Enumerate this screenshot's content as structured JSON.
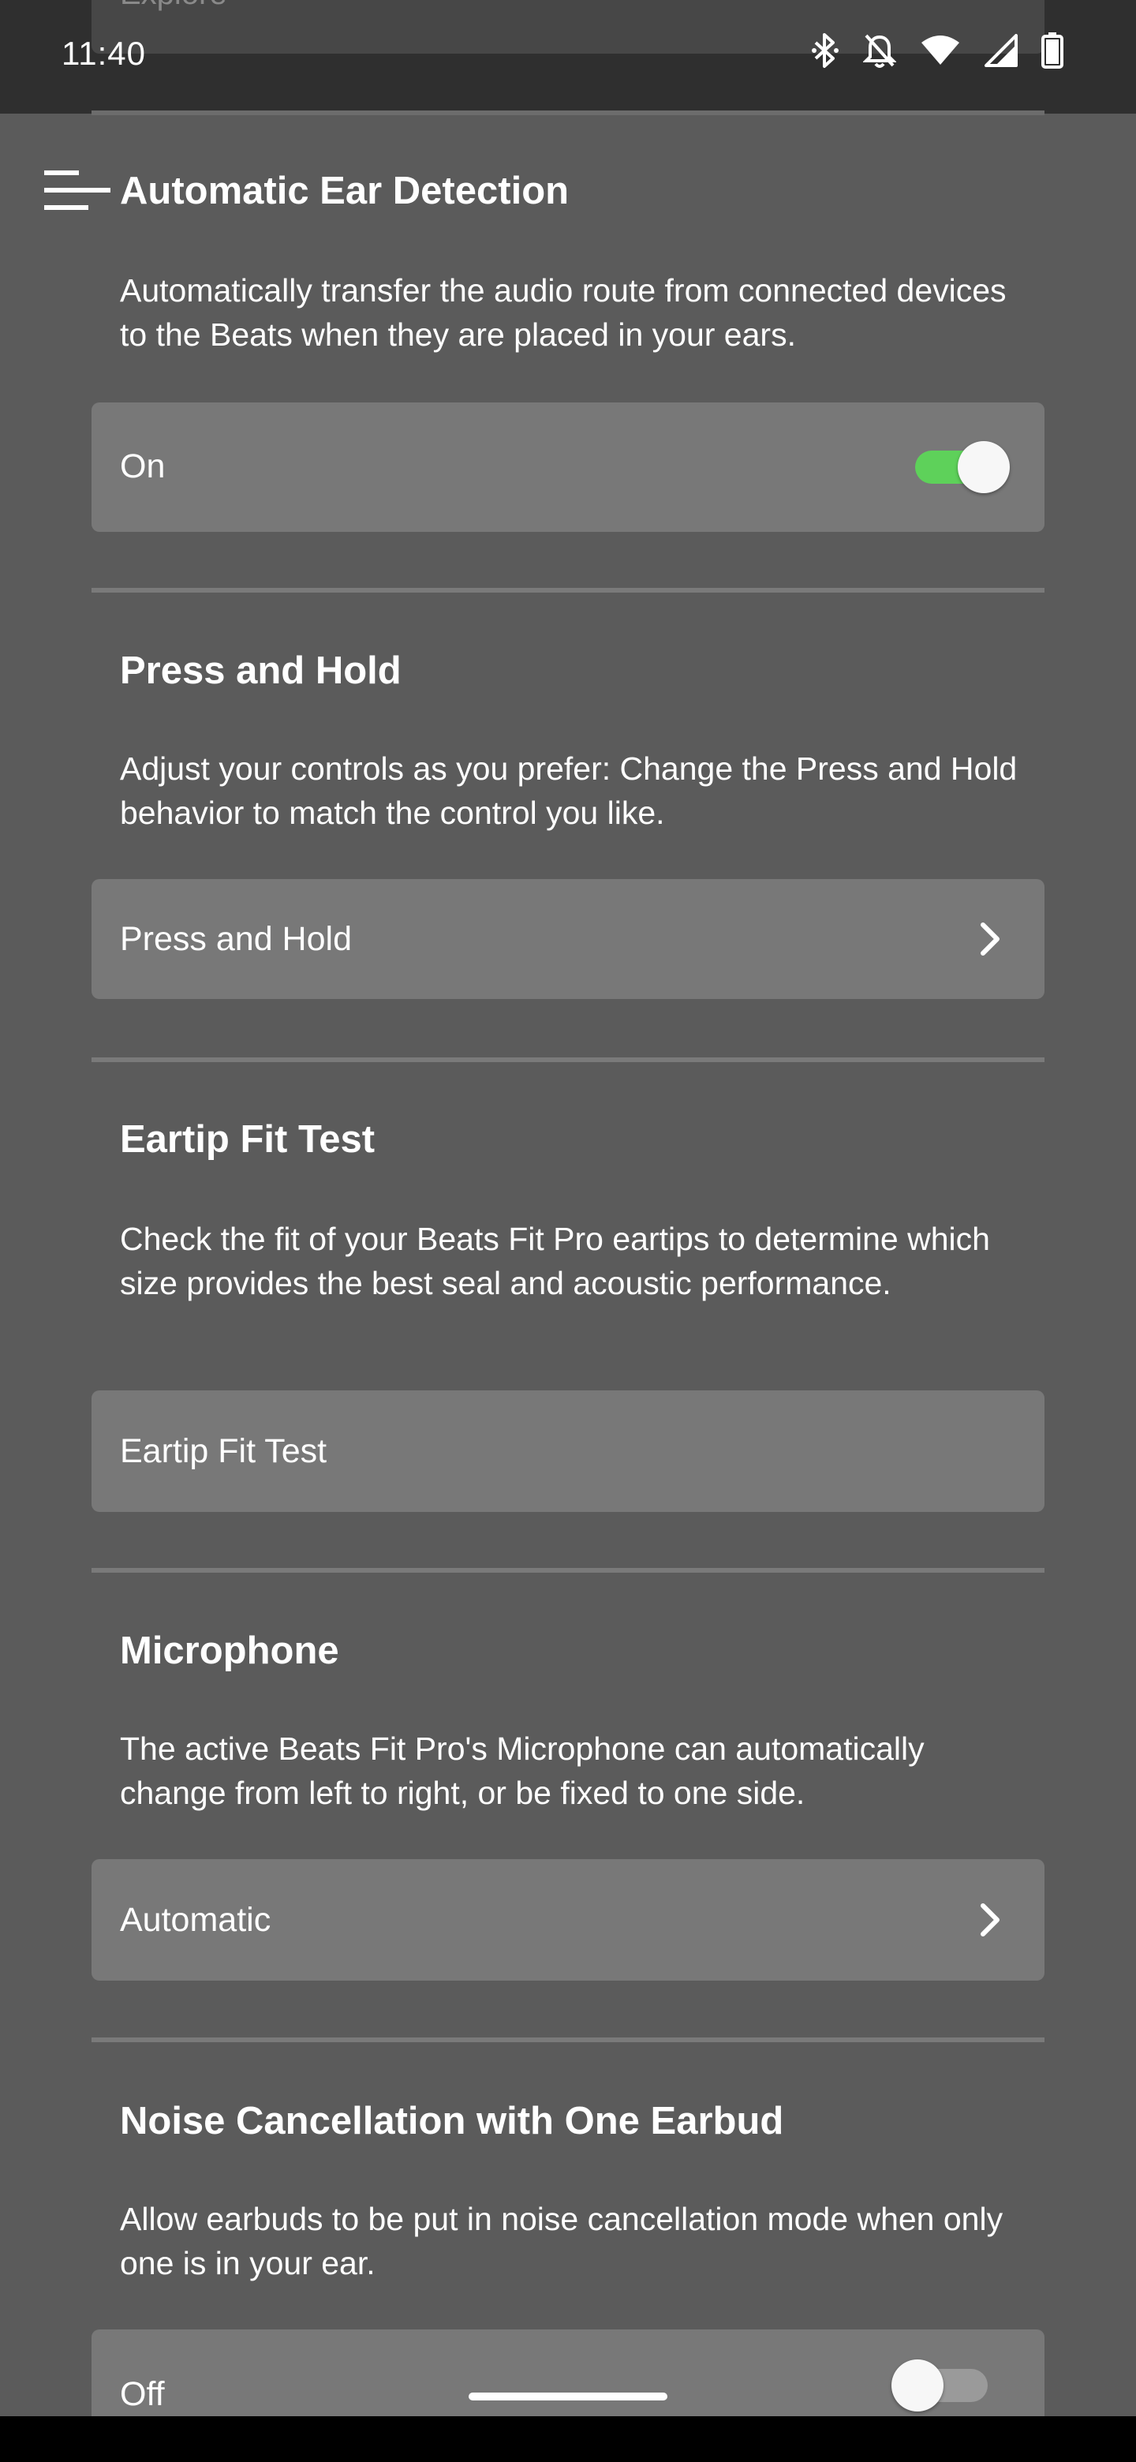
{
  "status_bar": {
    "time": "11:40",
    "icons": [
      "bluetooth-icon",
      "notifications-off-icon",
      "wifi-icon",
      "cell-signal-icon",
      "battery-icon"
    ]
  },
  "peek": {
    "label": "Explore"
  },
  "header": {
    "title": "Automatic Ear Detection"
  },
  "ear_detection": {
    "description": "Automatically transfer the audio route from connected devices to the Beats when they are placed in your ears.",
    "value_label": "On",
    "enabled": true
  },
  "press_hold": {
    "title": "Press and Hold",
    "description": "Adjust your controls as you prefer: Change the Press and Hold behavior to match the control you like.",
    "row_label": "Press and Hold"
  },
  "eartip": {
    "title": "Eartip Fit Test",
    "description": "Check the fit of your Beats Fit Pro eartips to determine which size provides the best seal and acoustic performance.",
    "row_label": "Eartip Fit Test"
  },
  "microphone": {
    "title": "Microphone",
    "description": "The active Beats Fit Pro's Microphone can automatically change from left to right, or be fixed to one side.",
    "row_label": "Automatic"
  },
  "noise_cancel": {
    "title": "Noise Cancellation with One Earbud",
    "description": "Allow earbuds to be put in noise cancellation mode when only one is in your ear.",
    "value_label": "Off",
    "enabled": false
  },
  "colors": {
    "background": "#5b5b5b",
    "card": "#787878",
    "toggle_on": "#5ed15a",
    "toggle_off": "#9a9a9a"
  }
}
